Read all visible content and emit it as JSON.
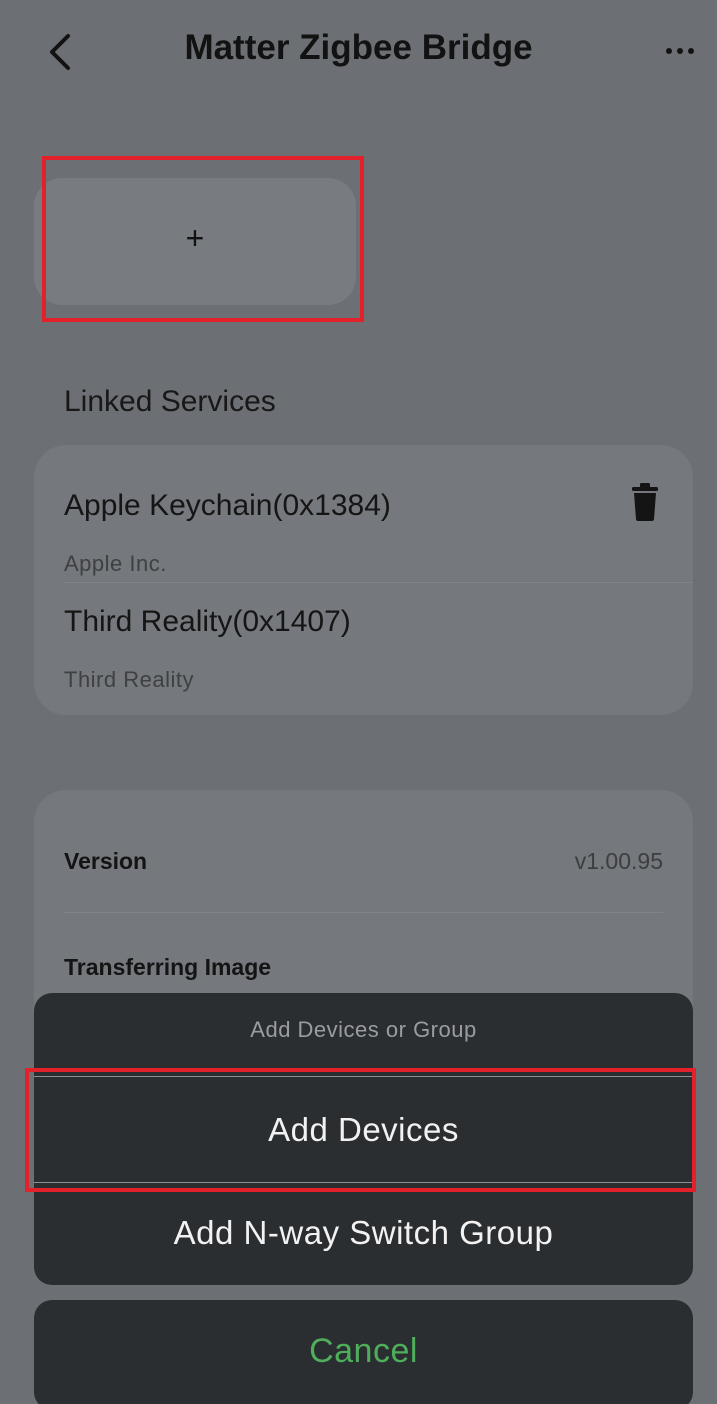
{
  "header": {
    "title": "Matter Zigbee Bridge",
    "back_icon": "chevron-left-icon",
    "more_icon": "more-horizontal-icon"
  },
  "add_tile": {
    "symbol": "+"
  },
  "linked_services": {
    "section_title": "Linked Services",
    "items": [
      {
        "name": "Apple Keychain(0x1384)",
        "vendor": "Apple Inc."
      },
      {
        "name": "Third Reality(0x1407)",
        "vendor": "Third Reality"
      }
    ],
    "delete_icon": "trash-icon"
  },
  "info": {
    "rows": [
      {
        "label": "Version",
        "value": "v1.00.95"
      },
      {
        "label": "Transferring Image",
        "value": ""
      }
    ]
  },
  "action_sheet": {
    "title": "Add Devices or Group",
    "options": [
      {
        "label": "Add Devices"
      },
      {
        "label": "Add N-way Switch Group"
      }
    ],
    "cancel_label": "Cancel"
  },
  "colors": {
    "highlight": "#e3212a",
    "cancel_text": "#4fae5b",
    "sheet_bg": "#2b2e31",
    "page_bg": "#6c6f73"
  }
}
